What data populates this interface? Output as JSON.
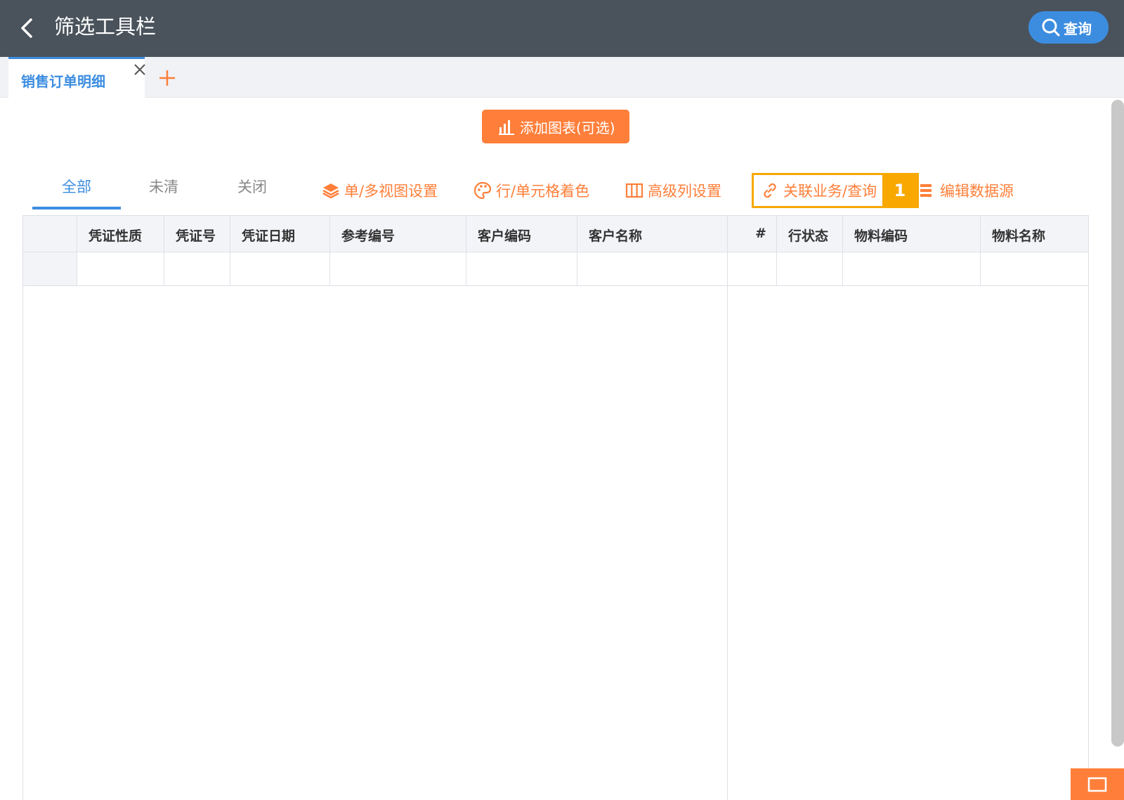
{
  "header": {
    "title": "筛选工具栏",
    "query_label": "查询"
  },
  "tabs": {
    "active_label": "销售订单明细"
  },
  "add_chart": {
    "label": "添加图表(可选)"
  },
  "status_tabs": [
    {
      "label": "全部",
      "active": true
    },
    {
      "label": "未清",
      "active": false
    },
    {
      "label": "关闭",
      "active": false
    }
  ],
  "actions": {
    "view_settings": "单/多视图设置",
    "cell_color": "行/单元格着色",
    "advanced_columns": "高级列设置",
    "related_business": "关联业务/查询",
    "edit_datasource": "编辑数据源",
    "badge": "1"
  },
  "table": {
    "columns": [
      "凭证性质",
      "凭证号",
      "凭证日期",
      "参考编号",
      "客户编码",
      "客户名称",
      "#",
      "行状态",
      "物料编码",
      "物料名称"
    ]
  },
  "colors": {
    "header_bg": "#4a535c",
    "accent": "#3c8de0",
    "orange": "#ff7f3a",
    "highlight": "#f8a800"
  }
}
